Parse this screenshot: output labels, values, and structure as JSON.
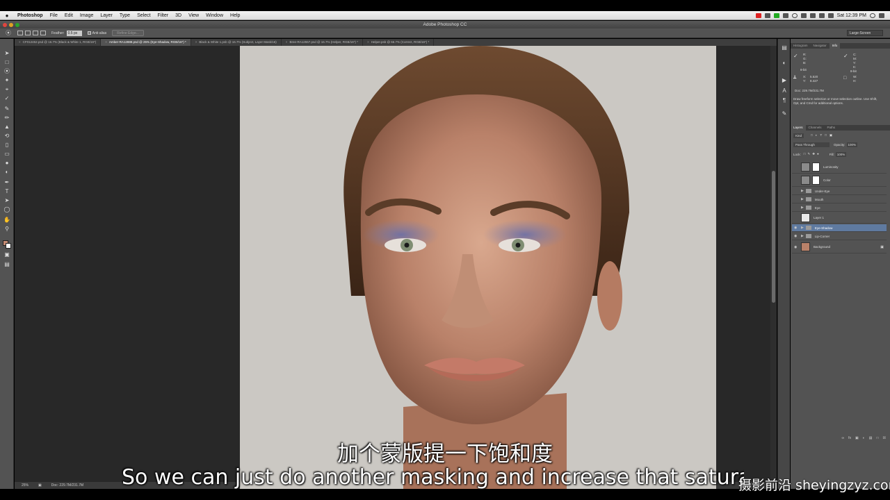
{
  "menubar": {
    "app_name": "Photoshop",
    "items": [
      "File",
      "Edit",
      "Image",
      "Layer",
      "Type",
      "Select",
      "Filter",
      "3D",
      "View",
      "Window",
      "Help"
    ],
    "clock": "Sat 12:39 PM"
  },
  "window": {
    "title": "Adobe Photoshop CC"
  },
  "options_bar": {
    "feather_label": "Feather:",
    "feather_value": "0.5 px",
    "anti_alias_label": "Anti-alias",
    "refine_edge_label": "Refine Edge...",
    "workspace": "Large-Screen"
  },
  "tabs": [
    "CF012452.psd @ 16.7% (Black & White 1, RGB/16*)",
    "Amber-RA12888.psd @ 25% (Eye-Shadow, RGB/16*) *",
    "Black & White 1.psb @ 16.7% (Subject, Layer Mask/16)",
    "Bree-RA12557.psd @ 16.7% (Helper, RGB/16*) *",
    "Helper.psb @ 66.7% (Correct, RGB/16*) *"
  ],
  "status": {
    "zoom": "25%",
    "doc": "Doc: 229.7M/231.7M"
  },
  "info_panel": {
    "tabs": [
      "Histogram",
      "Navigator",
      "Info"
    ],
    "r_label": "R:",
    "g_label": "G:",
    "b_label": "B:",
    "c_label": "C:",
    "m_label": "M:",
    "y_label": "Y:",
    "k_label": "K:",
    "bit_left": "8-bit",
    "bit_right": "8-bit",
    "x_label": "X:",
    "y2_label": "Y:",
    "x_value": "5.520",
    "y_value": "8.427",
    "w_label": "W:",
    "h_label": "H:",
    "doc": "Doc: 229.7M/231.7M",
    "hint": "Draw freeform selection or move selection outline. Use Shift, Opt, and Cmd for additional options."
  },
  "layers_panel": {
    "tabs": [
      "Layers",
      "Channels",
      "Paths"
    ],
    "kind_label": "Kind",
    "blend_mode": "Pass Through",
    "opacity_label": "Opacity:",
    "opacity_value": "100%",
    "lock_label": "Lock:",
    "fill_label": "Fill:",
    "fill_value": "100%",
    "layers": [
      {
        "name": "Luminosity",
        "type": "adjustment",
        "visible": false,
        "selected": false
      },
      {
        "name": "Color",
        "type": "adjustment",
        "visible": false,
        "selected": false
      },
      {
        "name": "Under-Eye",
        "type": "group",
        "visible": false,
        "selected": false
      },
      {
        "name": "Mouth",
        "type": "group",
        "visible": false,
        "selected": false
      },
      {
        "name": "Eye",
        "type": "group",
        "visible": false,
        "selected": false
      },
      {
        "name": "Layer 1",
        "type": "layer",
        "visible": false,
        "selected": false
      },
      {
        "name": "Eye-Shadow",
        "type": "group",
        "visible": true,
        "selected": true
      },
      {
        "name": "Lip-Corner",
        "type": "group",
        "visible": true,
        "selected": false
      },
      {
        "name": "Background",
        "type": "background",
        "visible": true,
        "selected": false
      }
    ]
  },
  "subtitles": {
    "chinese": "加个蒙版提一下饱和度",
    "english": "So we can just do another masking and increase that saturation",
    "watermark": "摄影前沿 sheyingzyz.com"
  },
  "colors": {
    "foreground": "#c48b74",
    "background": "#ffffff",
    "selected_layer": "#5f7aa0"
  }
}
